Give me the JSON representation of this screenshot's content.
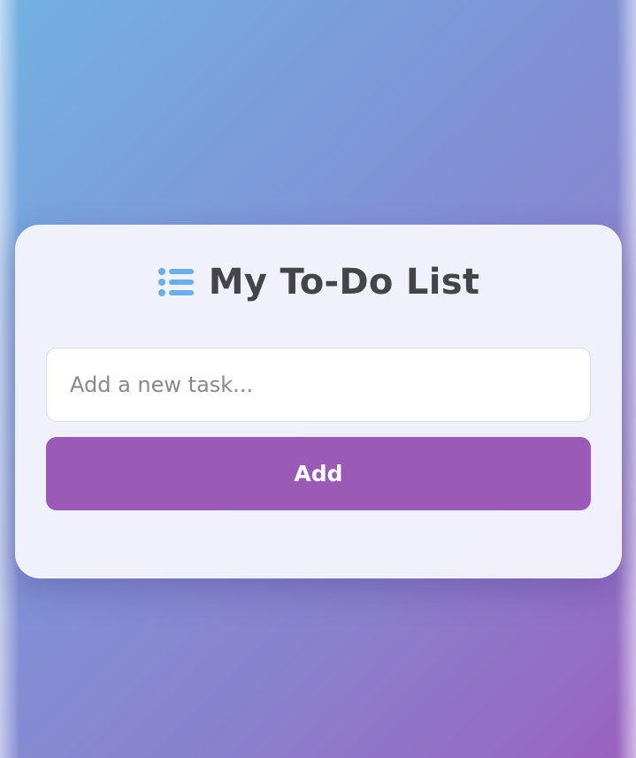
{
  "app": {
    "title": "My To-Do List",
    "title_icon": "list-icon"
  },
  "form": {
    "input_placeholder": "Add a new task...",
    "input_value": "",
    "add_button_label": "Add"
  },
  "colors": {
    "accent": "#9a5ab6",
    "icon": "#6aaee6",
    "title_text": "#444449"
  }
}
